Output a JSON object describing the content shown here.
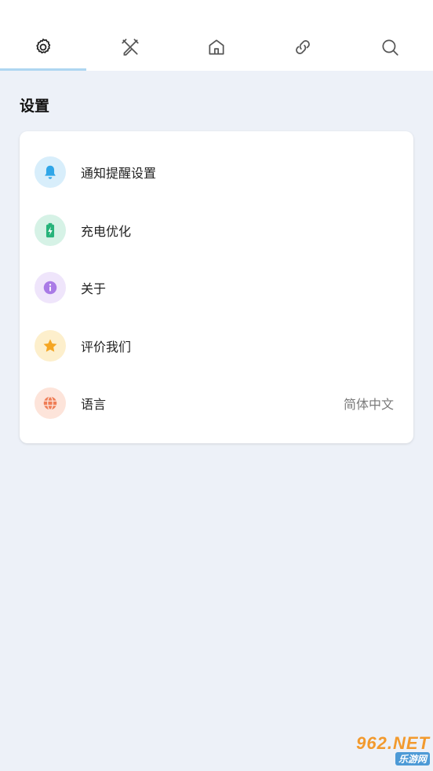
{
  "tabs": [
    {
      "icon": "gear-icon",
      "active": true
    },
    {
      "icon": "tools-icon",
      "active": false
    },
    {
      "icon": "home-icon",
      "active": false
    },
    {
      "icon": "link-icon",
      "active": false
    },
    {
      "icon": "search-icon",
      "active": false
    }
  ],
  "page_title": "设置",
  "settings": {
    "items": [
      {
        "label": "通知提醒设置",
        "icon": "bell-icon",
        "icon_color": "#2fa6e8",
        "bg": "#d8eefb"
      },
      {
        "label": "充电优化",
        "icon": "battery-charging-icon",
        "icon_color": "#27b37a",
        "bg": "#d6f2e6"
      },
      {
        "label": "关于",
        "icon": "info-icon",
        "icon_color": "#a97ae6",
        "bg": "#efe5fb"
      },
      {
        "label": "评价我们",
        "icon": "star-icon",
        "icon_color": "#f5a623",
        "bg": "#fdefcc"
      },
      {
        "label": "语言",
        "icon": "globe-icon",
        "icon_color": "#ef7e57",
        "bg": "#fde4da",
        "value": "简体中文"
      }
    ]
  },
  "watermark": {
    "top": "962.NET",
    "bottom": "乐游网"
  },
  "colors": {
    "background": "#edf1f8",
    "tab_indicator": "#aed6f1"
  }
}
